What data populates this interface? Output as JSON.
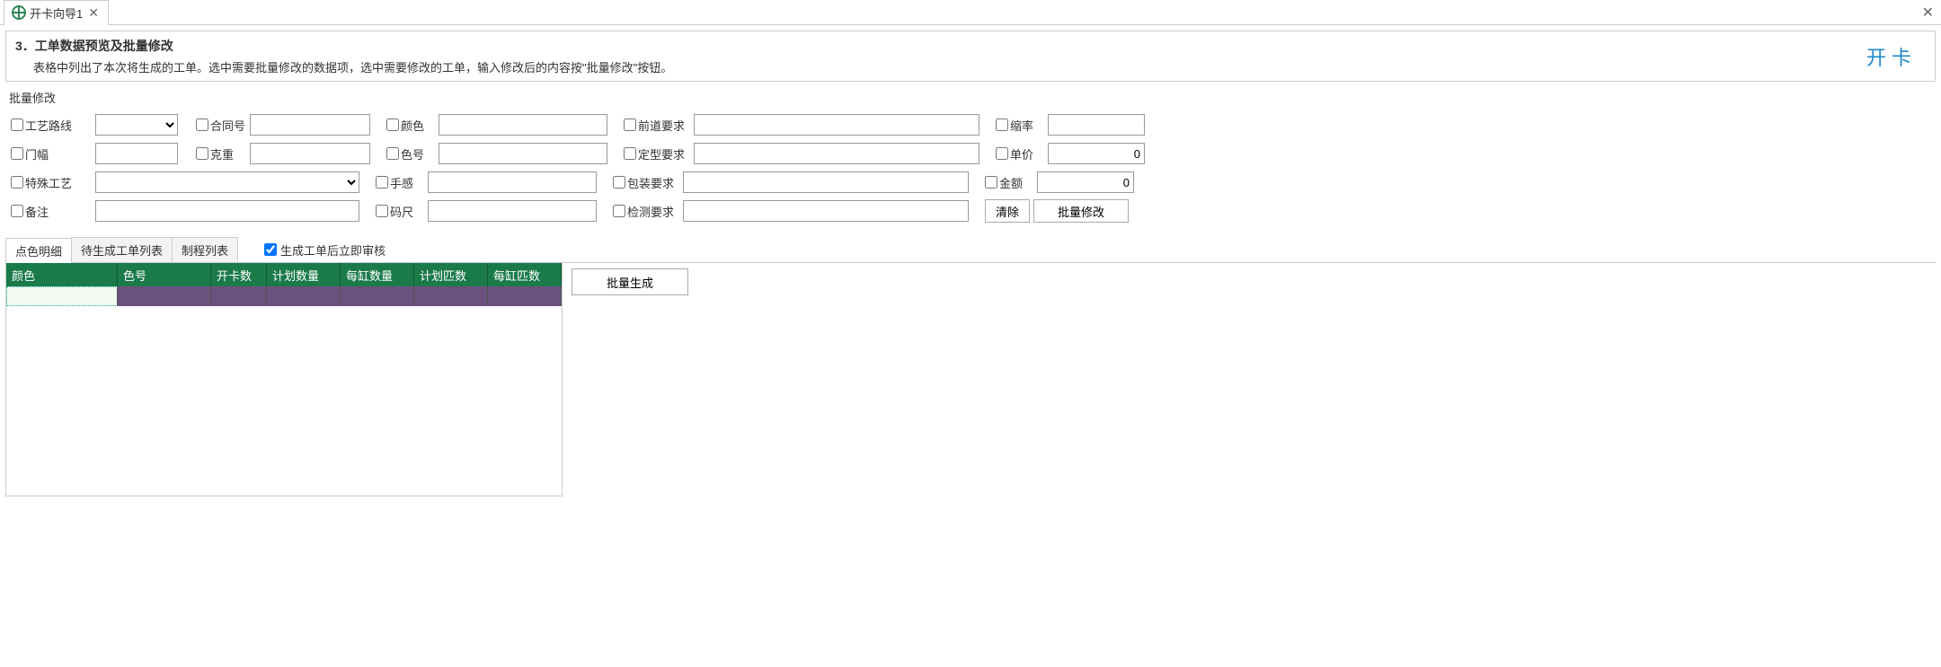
{
  "window": {
    "tab_title": "开卡向导1",
    "tab_close": "✕",
    "window_close": "✕"
  },
  "step": {
    "title": "3．工单数据预览及批量修改",
    "description": "表格中列出了本次将生成的工单。选中需要批量修改的数据项，选中需要修改的工单，输入修改后的内容按\"批量修改\"按钮。",
    "action_label": "开卡"
  },
  "batch_section_label": "批量修改",
  "form": {
    "process_route": "工艺路线",
    "door_width": "门幅",
    "special_process": "特殊工艺",
    "remark": "备注",
    "contract_no": "合同号",
    "gram_weight": "克重",
    "color": "颜色",
    "color_no": "色号",
    "hand_feel": "手感",
    "yard": "码尺",
    "front_req": "前道要求",
    "shape_req": "定型要求",
    "pack_req": "包装要求",
    "inspect_req": "检测要求",
    "shrink_rate": "缩率",
    "unit_price": "单价",
    "amount": "金额",
    "unit_price_value": "0",
    "amount_value": "0",
    "clear_btn": "清除",
    "batch_modify_btn": "批量修改"
  },
  "tabs": {
    "tab1": "点色明细",
    "tab2": "待生成工单列表",
    "tab3": "制程列表",
    "audit_check": "生成工单后立即审核"
  },
  "grid": {
    "headers": {
      "h1": "颜色",
      "h2": "色号",
      "h3": "开卡数",
      "h4": "计划数量",
      "h5": "每缸数量",
      "h6": "计划匹数",
      "h7": "每缸匹数"
    }
  },
  "generate_btn": "批量生成"
}
